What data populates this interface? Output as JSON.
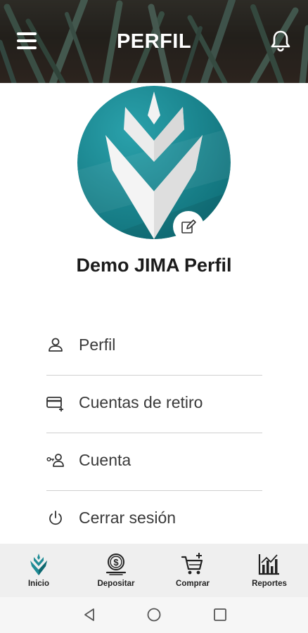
{
  "header": {
    "title": "PERFIL"
  },
  "profile": {
    "name": "Demo JIMA Perfil"
  },
  "menu": [
    {
      "label": "Perfil"
    },
    {
      "label": "Cuentas de retiro"
    },
    {
      "label": "Cuenta"
    },
    {
      "label": "Cerrar sesión"
    }
  ],
  "bottom_nav": [
    {
      "label": "Inicio",
      "icon": "agave-logo-icon"
    },
    {
      "label": "Depositar",
      "icon": "dollar-coin-icon"
    },
    {
      "label": "Comprar",
      "icon": "cart-add-icon"
    },
    {
      "label": "Reportes",
      "icon": "bar-chart-icon"
    }
  ],
  "colors": {
    "accent": "#1f8c96",
    "accent_dark": "#0f6870",
    "header_bg": "#2c2a24"
  }
}
